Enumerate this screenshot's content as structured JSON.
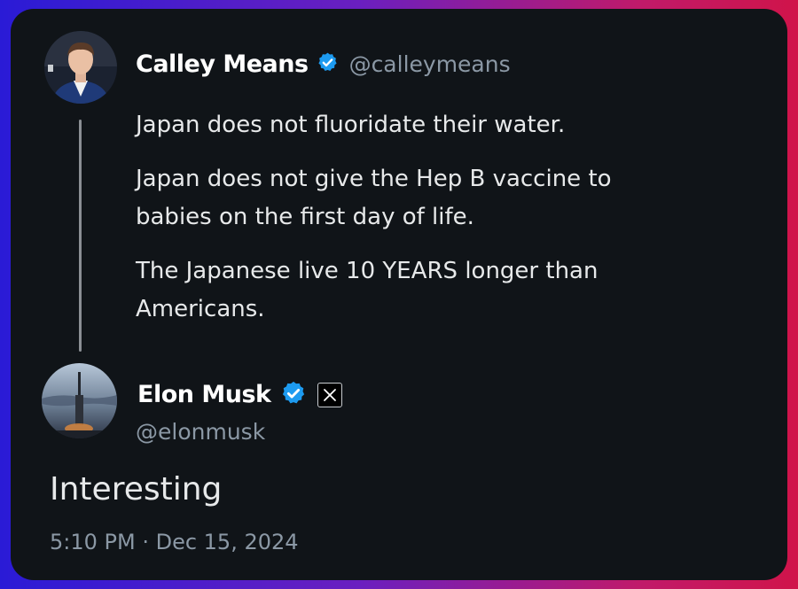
{
  "original_tweet": {
    "author_name": "Calley Means",
    "author_handle": "@calleymeans",
    "verified": true,
    "paragraphs": [
      "Japan does not fluoridate their water.",
      "Japan does not give the Hep B vaccine to babies on the first day of life.",
      "The Japanese live 10 YEARS longer than Americans."
    ]
  },
  "reply": {
    "author_name": "Elon Musk",
    "author_handle": "@elonmusk",
    "verified": true,
    "affiliate_badge": "x-logo-icon",
    "text": "Interesting",
    "timestamp": "5:10 PM · Dec 15, 2024"
  },
  "colors": {
    "card_background": "#101418",
    "verified_blue": "#1d9bf0",
    "handle_gray": "#8b98a5",
    "text": "#e7e9ea"
  }
}
